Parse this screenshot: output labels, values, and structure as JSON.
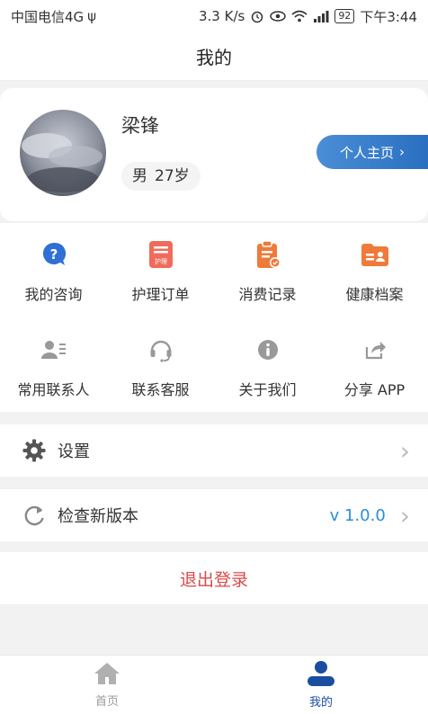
{
  "status_bar": {
    "carrier": "中国电信4G",
    "usb": "ψ",
    "speed": "3.3 K/s",
    "battery": "92",
    "time": "下午3:44"
  },
  "title": "我的",
  "profile": {
    "name": "梁锋",
    "gender": "男",
    "age": "27岁",
    "home_button": "个人主页",
    "home_chevron": "›"
  },
  "grid": [
    {
      "label": "我的咨询",
      "icon": "consult-icon",
      "color": "#2f6fd6"
    },
    {
      "label": "护理订单",
      "icon": "nursing-order-icon",
      "color": "#f06b5b"
    },
    {
      "label": "消费记录",
      "icon": "consumption-record-icon",
      "color": "#f07a3a"
    },
    {
      "label": "健康档案",
      "icon": "health-file-icon",
      "color": "#f07a3a"
    },
    {
      "label": "常用联系人",
      "icon": "contacts-icon",
      "color": "#999999"
    },
    {
      "label": "联系客服",
      "icon": "customer-service-icon",
      "color": "#999999"
    },
    {
      "label": "关于我们",
      "icon": "about-icon",
      "color": "#999999"
    },
    {
      "label": "分享 APP",
      "icon": "share-icon",
      "color": "#999999"
    }
  ],
  "nursing_badge": "护理",
  "settings": {
    "label": "设置",
    "chevron": "›"
  },
  "version": {
    "label": "检查新版本",
    "value": "v 1.0.0",
    "chevron": "›"
  },
  "logout": "退出登录",
  "tabs": [
    {
      "label": "首页",
      "active": false
    },
    {
      "label": "我的",
      "active": true
    }
  ],
  "colors": {
    "accent": "#2a6fc0",
    "active_tab": "#1a4fa0",
    "inactive_tab": "#999999",
    "logout": "#d94a4a"
  }
}
